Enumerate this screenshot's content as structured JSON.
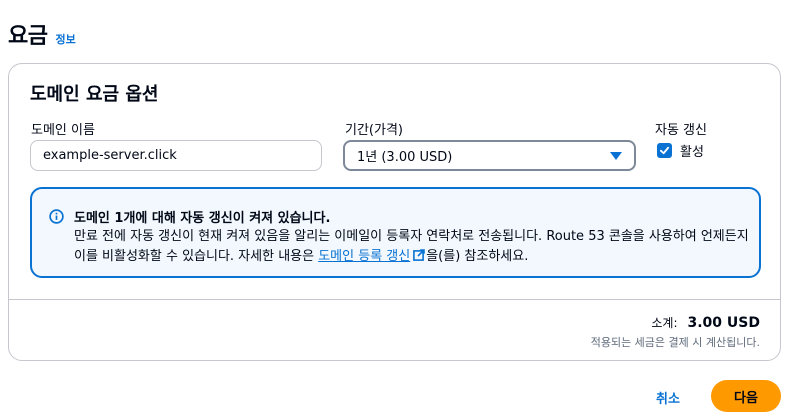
{
  "header": {
    "title": "요금",
    "info_link": "정보"
  },
  "card": {
    "title": "도메인 요금 옵션",
    "domain_name": {
      "label": "도메인 이름",
      "value": "example-server.click"
    },
    "period": {
      "label": "기간(가격)",
      "selected": "1년 (3.00 USD)"
    },
    "auto_renew": {
      "label": "자동 갱신",
      "checkbox_label": "활성",
      "checked": true
    },
    "alert": {
      "title": "도메인 1개에 대해 자동 갱신이 켜져 있습니다.",
      "body_part1": "만료 전에 자동 갱신이 현재 켜져 있음을 알리는 이메일이 등록자 연락처로 전송됩니다. Route 53 콘솔을 사용하여 언제든지 이를 비활성화할 수 있습니다. 자세한 내용은 ",
      "link_text": "도메인 등록 갱신",
      "body_part2": "을(를) 참조하세요."
    },
    "subtotal": {
      "label": "소계:",
      "value": "3.00 USD",
      "note": "적용되는 세금은 결제 시 계산됩니다."
    }
  },
  "footer": {
    "cancel_label": "취소",
    "next_label": "다음"
  },
  "colors": {
    "accent": "#0972d3",
    "primary_button": "#ff9900",
    "alert_bg": "#f2f8fd"
  }
}
